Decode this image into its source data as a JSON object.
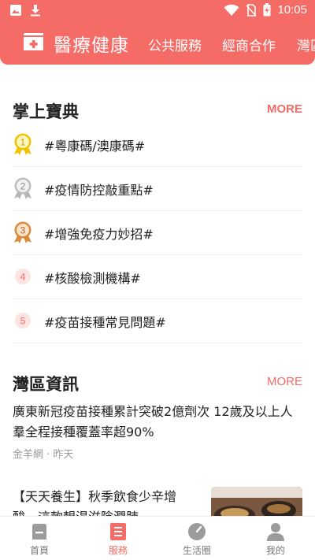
{
  "status_bar": {
    "time": "10:05",
    "left_icons": [
      "image-icon",
      "download-icon"
    ],
    "right_icons": [
      "wifi-icon",
      "no-sim-icon",
      "battery-charging-icon"
    ]
  },
  "header": {
    "brand_icon": "medical-kit-icon",
    "title": "醫療健康",
    "tabs": [
      "公共服務",
      "經商合作",
      "灣區"
    ],
    "background_color": "#f56b66"
  },
  "handbook": {
    "title": "掌上寶典",
    "more": "MORE",
    "items": [
      {
        "rank": "1",
        "label": "#粵康碼/澳康碼#",
        "badge": "gold-medal-icon"
      },
      {
        "rank": "2",
        "label": "#疫情防控敲重點#",
        "badge": "silver-medal-icon"
      },
      {
        "rank": "3",
        "label": "#增強免疫力妙招#",
        "badge": "bronze-medal-icon"
      },
      {
        "rank": "4",
        "label": "#核酸檢測機構#",
        "badge": "rank-circle-icon"
      },
      {
        "rank": "5",
        "label": "#疫苗接種常見問題#",
        "badge": "rank-circle-icon"
      }
    ]
  },
  "news": {
    "title": "灣區資訊",
    "more": "MORE",
    "articles": [
      {
        "title": "廣東新冠疫苗接種累計突破2億劑次 12歲及以上人羣全程接種覆蓋率超90%",
        "meta": "金羊網 · 昨天"
      },
      {
        "title": "【天天養生】秋季飲食少辛增酸，這款靚湯滋陰潤肺",
        "thumbnail": "food-photo"
      }
    ]
  },
  "bottom_nav": {
    "items": [
      {
        "label": "首頁",
        "icon": "home-icon",
        "active": false
      },
      {
        "label": "服務",
        "icon": "services-icon",
        "active": true
      },
      {
        "label": "生活圈",
        "icon": "compass-icon",
        "active": false
      },
      {
        "label": "我的",
        "icon": "profile-icon",
        "active": false
      }
    ],
    "active_color": "#f56b66"
  }
}
